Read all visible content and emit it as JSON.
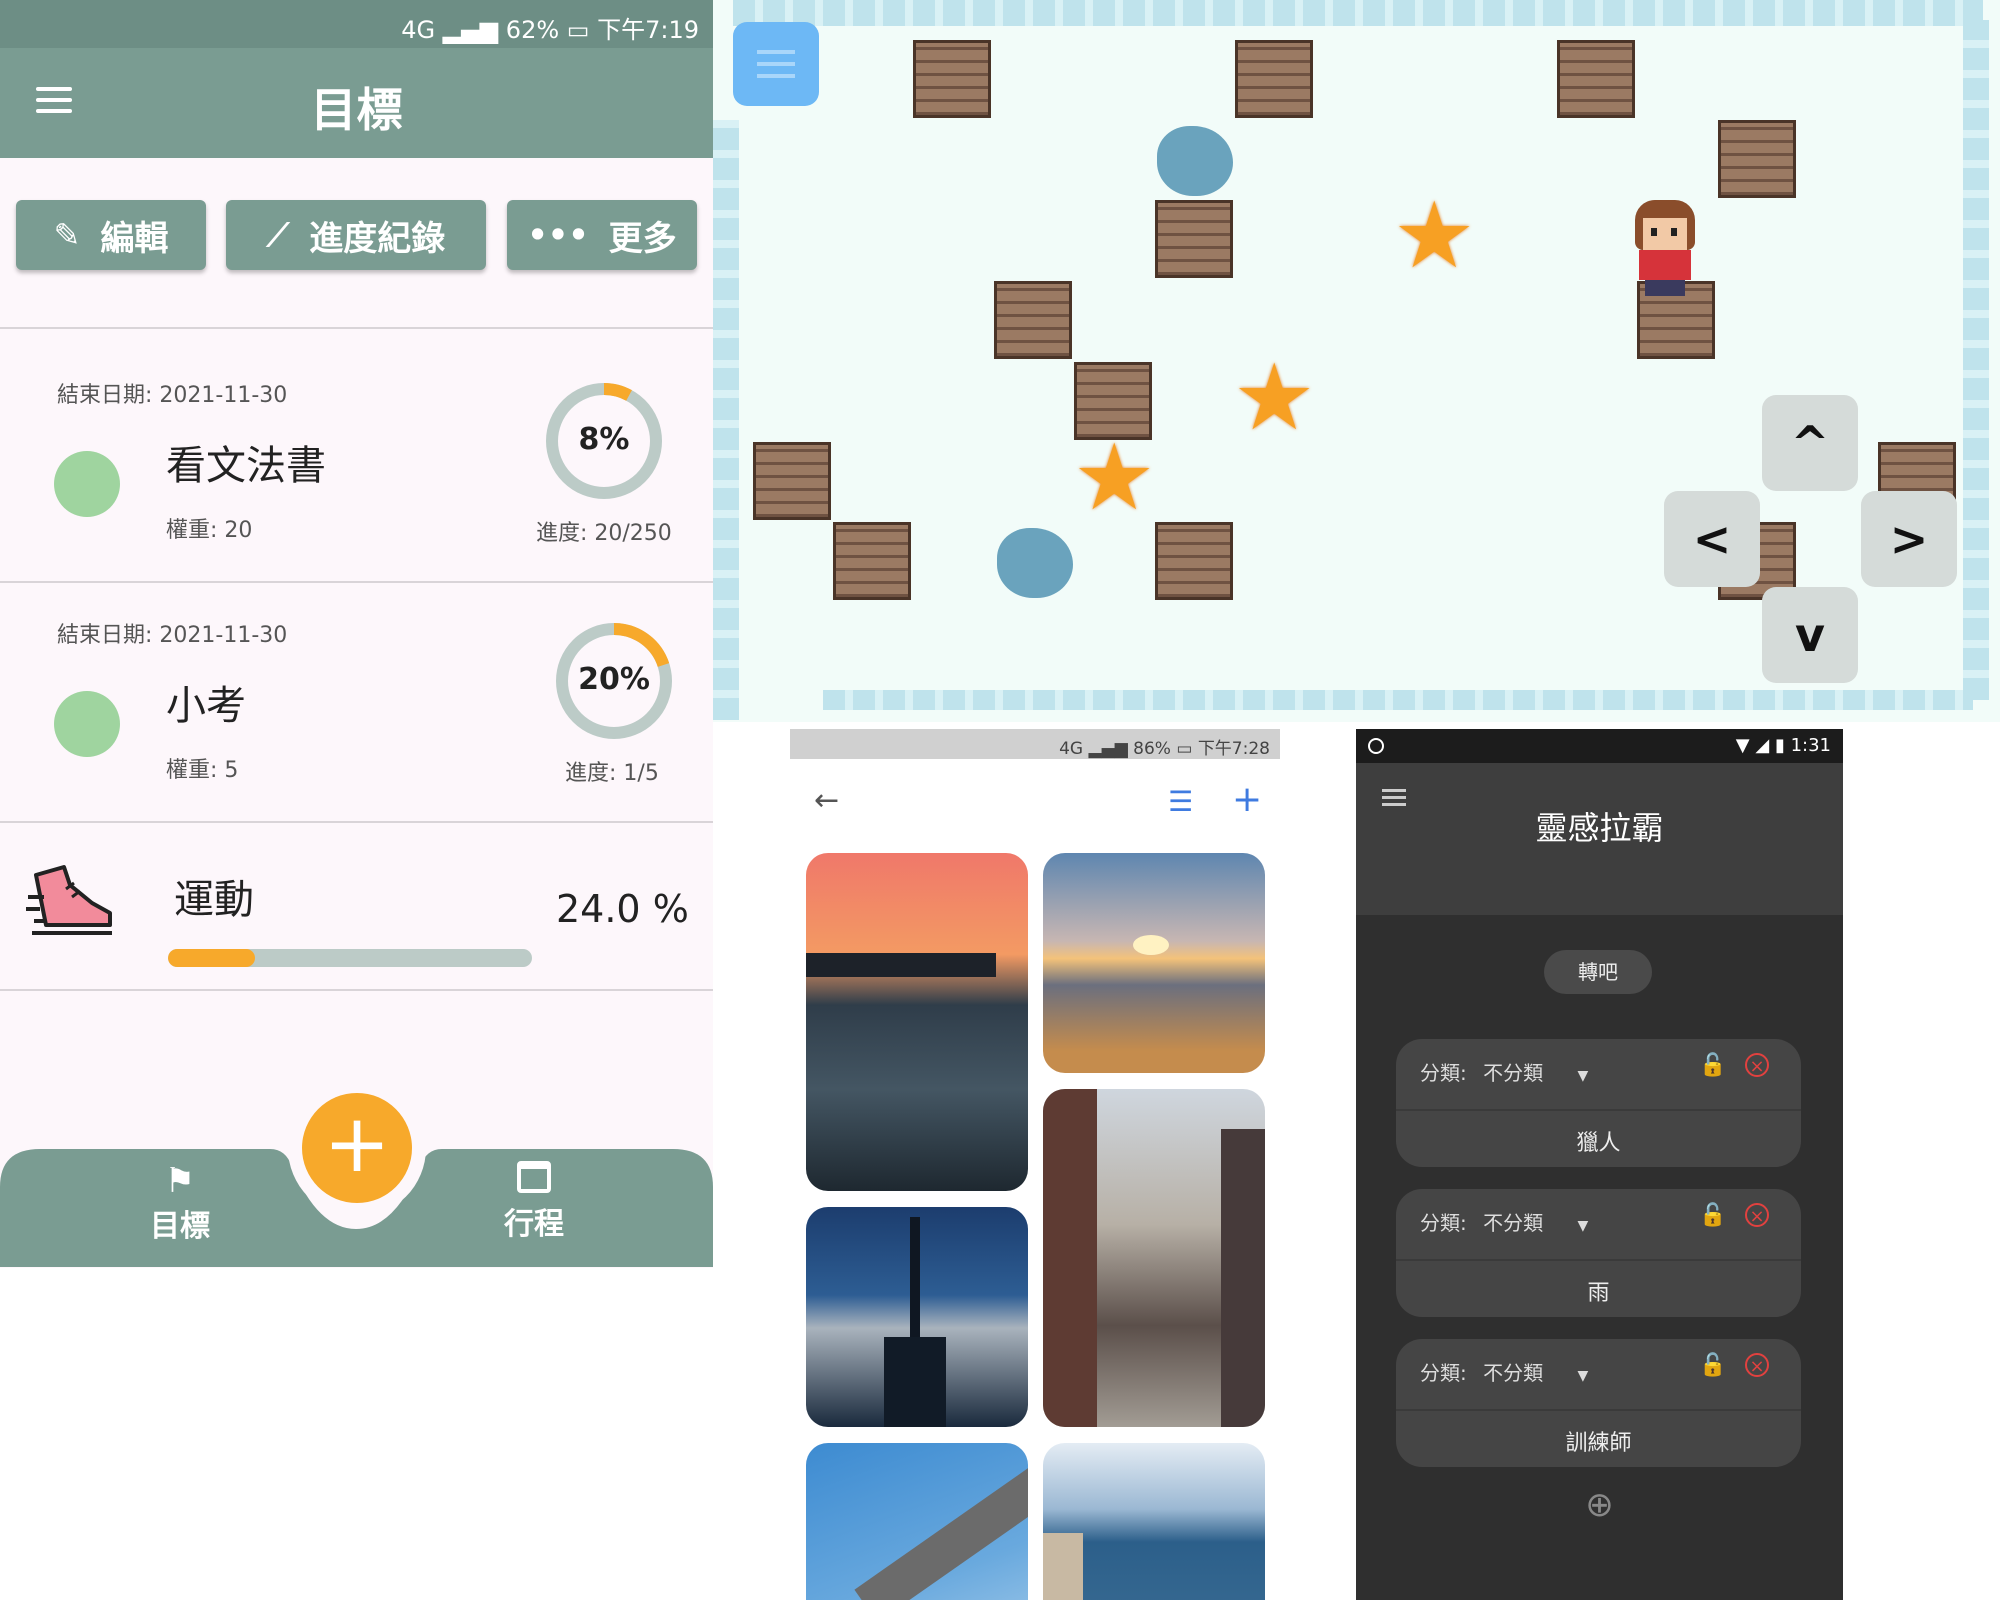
{
  "goals_app": {
    "status_bar": {
      "network": "4G",
      "battery": "62%",
      "time": "下午7:19"
    },
    "title": "目標",
    "actions": [
      {
        "icon": "pencil-icon",
        "label": "編輯"
      },
      {
        "icon": "trend-icon",
        "label": "進度紀錄"
      },
      {
        "icon": "more-dots-icon",
        "label": "更多"
      }
    ],
    "goals": [
      {
        "end_date": "結束日期: 2021-11-30",
        "name": "看文法書",
        "weight": "權重: 20",
        "percent_label": "8%",
        "percent": 8,
        "progress": "進度: 20/250"
      },
      {
        "end_date": "結束日期: 2021-11-30",
        "name": "小考",
        "weight": "權重: 5",
        "percent_label": "20%",
        "percent": 20,
        "progress": "進度: 1/5"
      }
    ],
    "category": {
      "name": "運動",
      "percent_label": "24.0 %",
      "percent": 24
    },
    "fab": "+",
    "nav": [
      {
        "icon": "flag-icon",
        "label": "目標"
      },
      {
        "icon": "calendar-icon",
        "label": "行程"
      }
    ],
    "colors": {
      "primary": "#7a9c92",
      "accent": "#f7a92b",
      "dot": "#9fd49f"
    }
  },
  "game": {
    "menu_icon": "menu-icon",
    "dpad": {
      "up": "^",
      "left": "<",
      "right": ">",
      "down": "v"
    }
  },
  "gallery": {
    "status_bar": {
      "network": "4G",
      "battery": "86%",
      "time": "下午7:28"
    },
    "icons": {
      "back": "←",
      "list": "☰",
      "add": "+"
    }
  },
  "inspiration": {
    "status_bar": {
      "time": "1:31"
    },
    "title": "靈感拉霸",
    "spin_button": "轉吧",
    "cards": [
      {
        "category_label": "分類:",
        "category_value": "不分類",
        "value": "獵人"
      },
      {
        "category_label": "分類:",
        "category_value": "不分類",
        "value": "雨"
      },
      {
        "category_label": "分類:",
        "category_value": "不分類",
        "value": "訓練師"
      }
    ],
    "add_icon": "⊕"
  }
}
